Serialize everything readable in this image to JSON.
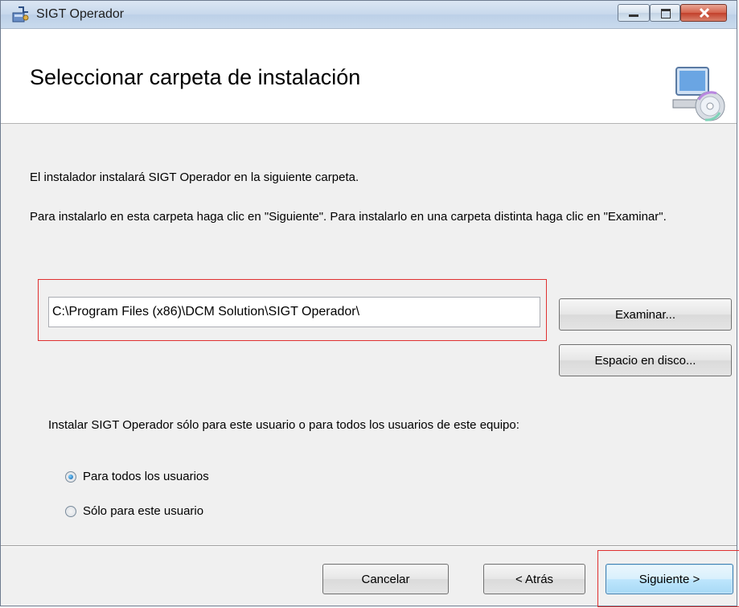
{
  "window": {
    "title": "SIGT Operador"
  },
  "header": {
    "title": "Seleccionar carpeta de instalación"
  },
  "content": {
    "line1": "El instalador instalará SIGT Operador en la siguiente carpeta.",
    "line2": "Para instalarlo en esta carpeta haga clic en \"Siguiente\". Para instalarlo en una carpeta distinta haga clic en \"Examinar\".",
    "folder_path": "C:\\Program Files (x86)\\DCM Solution\\SIGT Operador\\",
    "browse_label": "Examinar...",
    "disk_space_label": "Espacio en disco...",
    "scope_prompt": "Instalar SIGT Operador sólo para este usuario o para todos los usuarios de este equipo:",
    "options": [
      {
        "label": "Para todos los usuarios",
        "checked": true
      },
      {
        "label": "Sólo para este usuario",
        "checked": false
      }
    ]
  },
  "footer": {
    "cancel_label": "Cancelar",
    "back_label": "< Atrás",
    "next_label": "Siguiente >"
  },
  "colors": {
    "highlight_border": "#e03030",
    "next_button_border": "#3c7fb1"
  }
}
